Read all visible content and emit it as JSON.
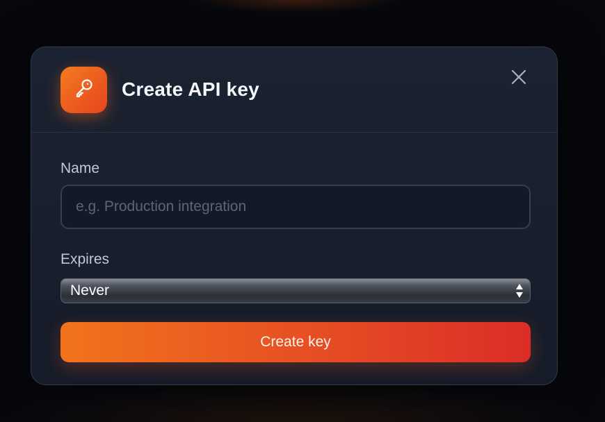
{
  "dialog": {
    "title": "Create API key",
    "icon": "key-icon",
    "close_icon": "close-icon"
  },
  "form": {
    "name": {
      "label": "Name",
      "placeholder": "e.g. Production integration",
      "value": ""
    },
    "expires": {
      "label": "Expires",
      "selected": "Never"
    },
    "submit_label": "Create key"
  },
  "colors": {
    "accent_start": "#f2731c",
    "accent_end": "#dc2d27",
    "dialog_bg": "#1b2231",
    "page_bg": "#07080d"
  }
}
